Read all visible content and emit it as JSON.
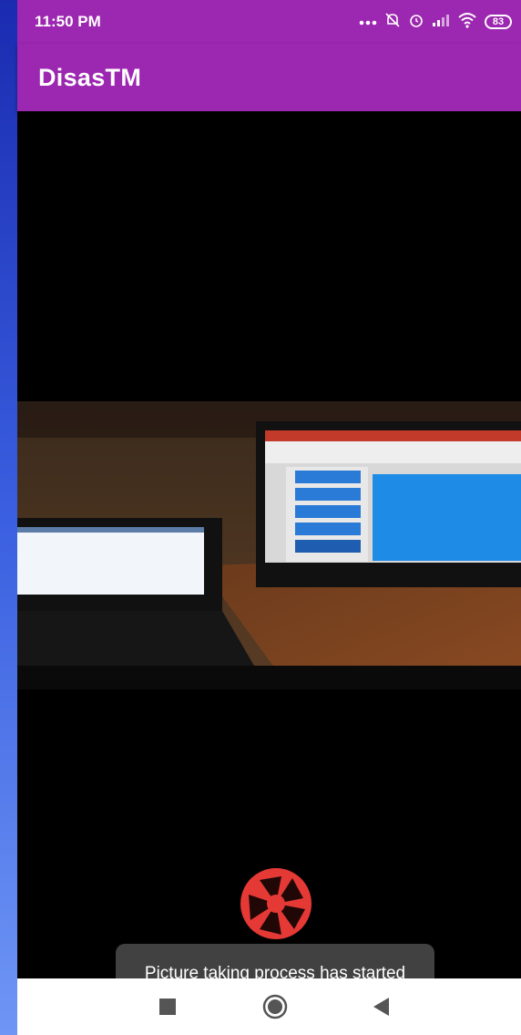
{
  "status_bar": {
    "time": "11:50 PM",
    "battery_level": "83",
    "icons": [
      "more-dots-icon",
      "bell-off-icon",
      "alarm-icon",
      "signal-icon",
      "wifi-icon",
      "battery-icon"
    ]
  },
  "app_bar": {
    "title": "DisasTM"
  },
  "toast": {
    "message": "Picture taking process has started"
  },
  "shutter": {
    "icon": "camera-aperture-icon",
    "color": "#e53935"
  },
  "nav": {
    "icons": [
      "recents-square-icon",
      "home-circle-icon",
      "back-triangle-icon"
    ]
  },
  "colors": {
    "accent": "#9c27b0",
    "shutter": "#e53935"
  }
}
